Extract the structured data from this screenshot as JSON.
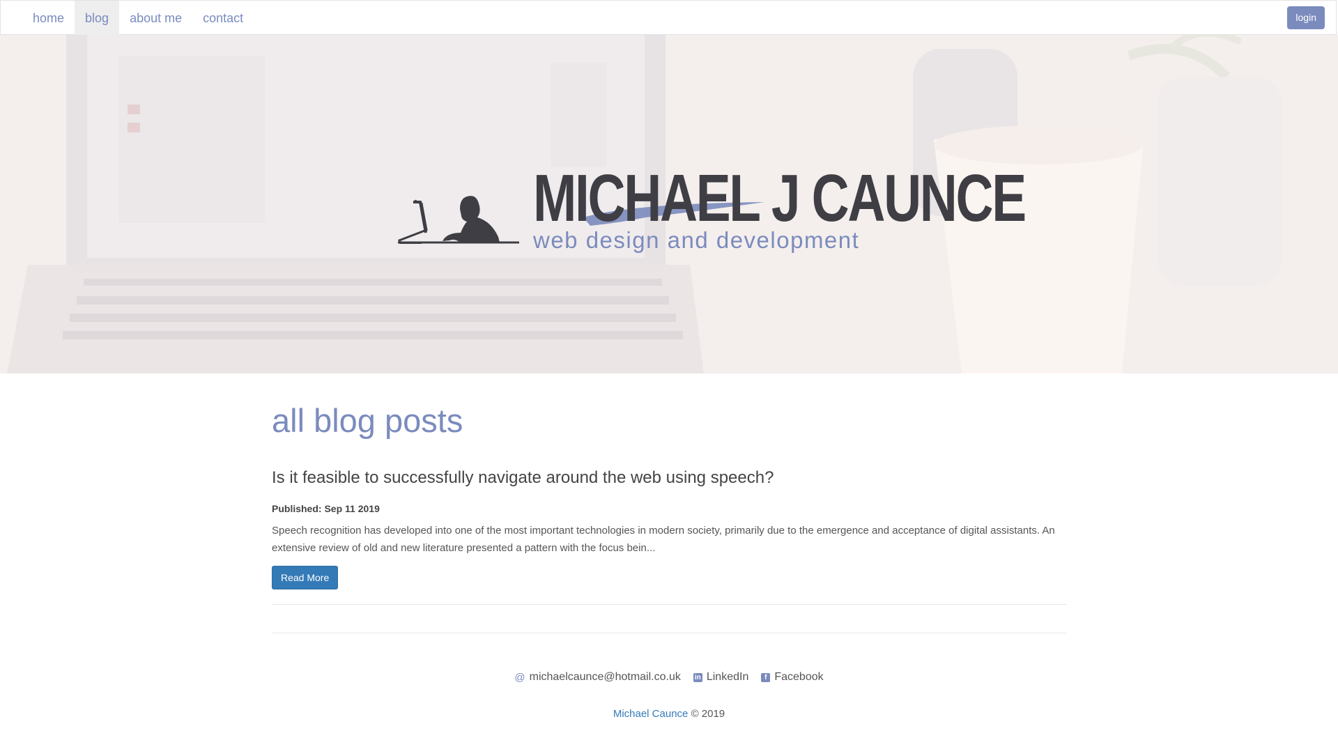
{
  "nav": {
    "items": [
      {
        "label": "home",
        "active": false
      },
      {
        "label": "blog",
        "active": true
      },
      {
        "label": "about me",
        "active": false
      },
      {
        "label": "contact",
        "active": false
      }
    ],
    "login_label": "login"
  },
  "hero": {
    "logo_name": "MICHAEL J CAUNCE",
    "logo_tagline": "web design and development"
  },
  "main": {
    "page_title": "all blog posts",
    "posts": [
      {
        "title": "Is it feasible to successfully navigate around the web using speech?",
        "published_label": "Published:",
        "published_date": "Sep 11 2019",
        "excerpt": "Speech recognition has developed into one of the most important technologies in modern society, primarily due to the emergence and acceptance of digital assistants. An extensive review of old and new literature presented a pattern with the focus bein...",
        "read_more_label": "Read More"
      }
    ]
  },
  "footer": {
    "email_icon": "at-icon",
    "email": "michaelcaunce@hotmail.co.uk",
    "linkedin_icon": "linkedin-icon",
    "linkedin_label": "LinkedIn",
    "facebook_icon": "facebook-icon",
    "facebook_label": "Facebook",
    "copyright_name": "Michael Caunce",
    "copyright_suffix": "© 2019"
  },
  "colors": {
    "accent": "#7b8bbd",
    "link": "#337ab7",
    "button": "#337ab7"
  }
}
